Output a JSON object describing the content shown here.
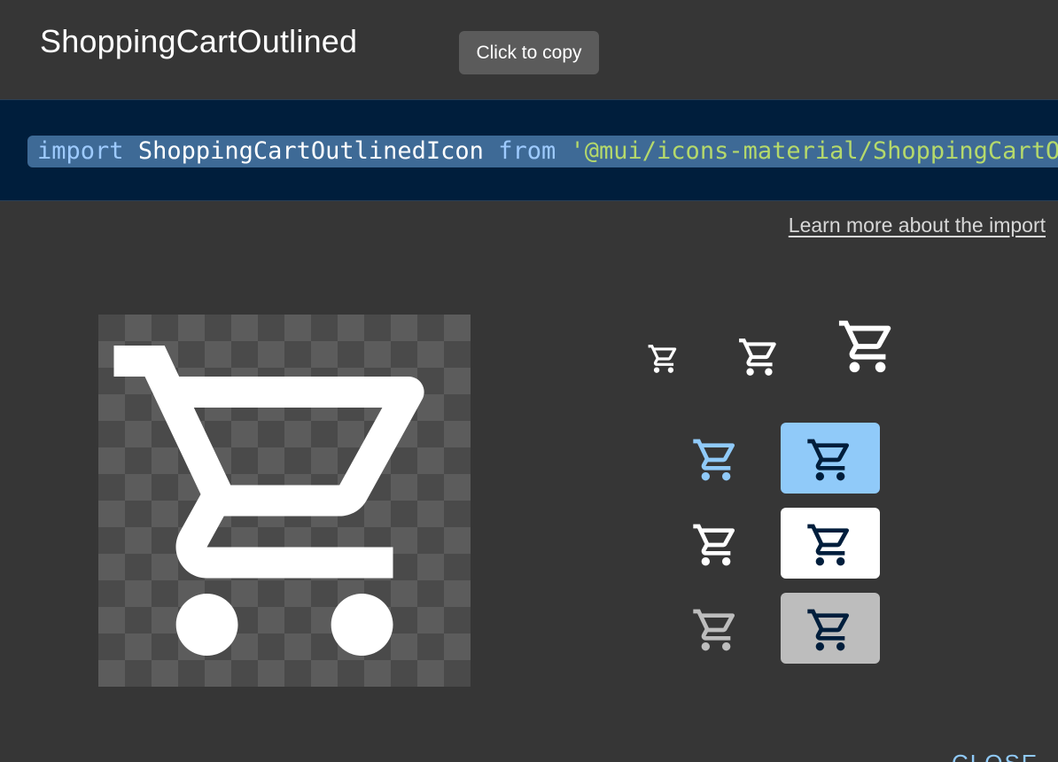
{
  "dialog": {
    "title": "ShoppingCartOutlined",
    "tooltip": "Click to copy",
    "code": {
      "keyword_import": "import",
      "identifier": "ShoppingCartOutlinedIcon",
      "keyword_from": "from",
      "module": "'@mui/icons-material/ShoppingCartOutlined';"
    },
    "learn_more_link": "Learn more about the import",
    "icon_name": "shopping-cart-outlined-icon",
    "sizes": [
      "small",
      "medium",
      "large"
    ],
    "variants": [
      {
        "name": "primary",
        "plain_color": "#90caf9",
        "box_bg": "#90caf9",
        "box_icon": "#001e3c"
      },
      {
        "name": "default",
        "plain_color": "#ffffff",
        "box_bg": "#ffffff",
        "box_icon": "#001e3c"
      },
      {
        "name": "disabled",
        "plain_color": "#bdbdbd",
        "box_bg": "#bdbdbd",
        "box_icon": "#001e3c"
      }
    ],
    "footer_button": "CLOSE",
    "colors": {
      "background": "#363636",
      "code_background": "#001e3c",
      "highlight": "#3e6a96",
      "keyword": "#9ecbff",
      "string": "#b5d96b"
    }
  }
}
